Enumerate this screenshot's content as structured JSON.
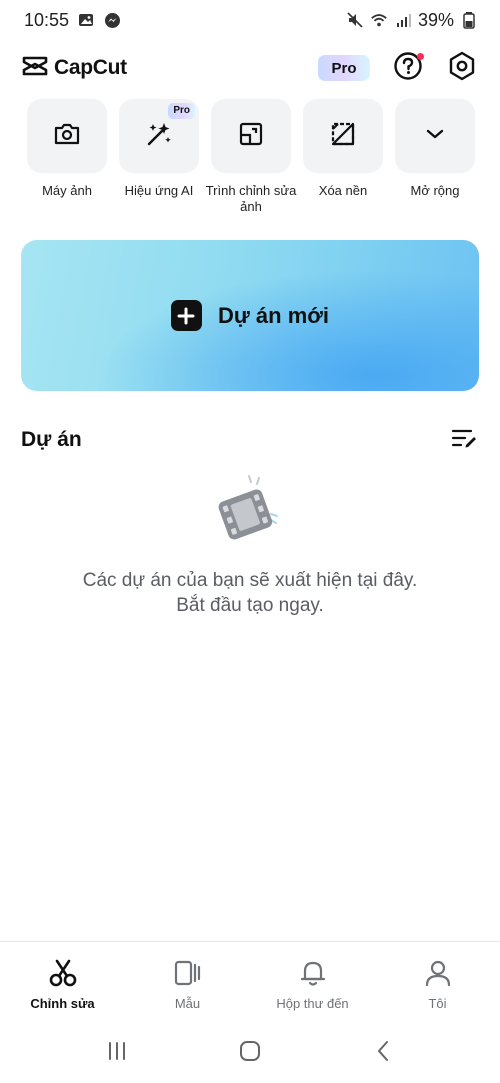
{
  "status_bar": {
    "time": "10:55",
    "battery": "39%",
    "icons": [
      "gallery-icon",
      "messenger-icon",
      "mute-icon",
      "wifi-icon",
      "signal-icon",
      "battery-icon"
    ]
  },
  "header": {
    "app_name": "CapCut",
    "pro_label": "Pro",
    "icons": [
      "capcut-logo-icon",
      "help-icon",
      "settings-icon"
    ],
    "notification_dot_color": "#fe2c55"
  },
  "tools": [
    {
      "label": "Máy ảnh",
      "icon": "camera-icon",
      "pro": ""
    },
    {
      "label": "Hiệu ứng AI",
      "icon": "magic-wand-icon",
      "pro": "Pro"
    },
    {
      "label": "Trình chỉnh sửa ảnh",
      "icon": "photo-editor-icon",
      "pro": ""
    },
    {
      "label": "Xóa nền",
      "icon": "remove-background-icon",
      "pro": ""
    },
    {
      "label": "Mở rộng",
      "icon": "chevron-down-icon",
      "pro": ""
    }
  ],
  "new_project": {
    "label": "Dự án mới",
    "icon": "plus-icon"
  },
  "projects": {
    "title": "Dự án",
    "sort_icon": "edit-list-icon",
    "empty_line1": "Các dự án của bạn sẽ xuất hiện tại đây.",
    "empty_line2": "Bắt đầu tạo ngay.",
    "empty_icon": "film-strip-icon"
  },
  "bottom_nav": [
    {
      "label": "Chỉnh sửa",
      "icon": "scissors-icon",
      "active": true
    },
    {
      "label": "Mẫu",
      "icon": "template-icon",
      "active": false
    },
    {
      "label": "Hộp thư đến",
      "icon": "bell-icon",
      "active": false
    },
    {
      "label": "Tôi",
      "icon": "profile-icon",
      "active": false
    }
  ],
  "system_nav": [
    "recent-apps-icon",
    "home-icon",
    "back-icon"
  ],
  "colors": {
    "accent_banner": "#7fd0f1",
    "text_primary": "#111111",
    "text_secondary": "#5a5d63"
  }
}
